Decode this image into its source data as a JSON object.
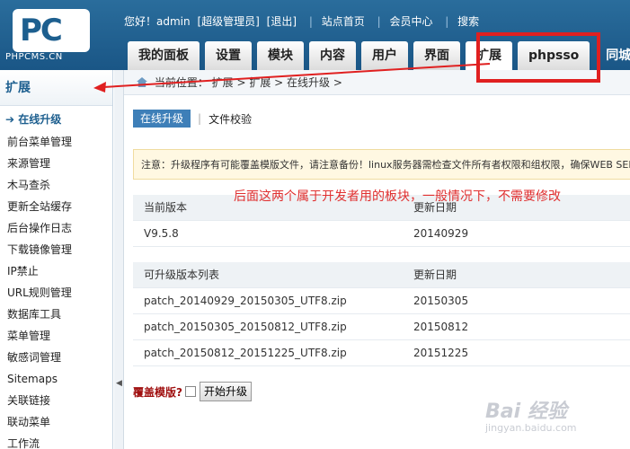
{
  "brand": {
    "logo_text": "PC",
    "logo_sub": "PHPCMS.CN"
  },
  "topbar": {
    "greeting": "您好！admin",
    "role": "[超级管理员]",
    "logout": "[退出]",
    "site_home": "站点首页",
    "member_center": "会员中心",
    "search": "搜索"
  },
  "nav_tabs": [
    "我的面板",
    "设置",
    "模块",
    "内容",
    "用户",
    "界面",
    "扩展",
    "phpsso",
    "同城"
  ],
  "sidebar": {
    "title": "扩展",
    "items": [
      "在线升级",
      "前台菜单管理",
      "来源管理",
      "木马查杀",
      "更新全站缓存",
      "后台操作日志",
      "下载镜像管理",
      "IP禁止",
      "URL规则管理",
      "数据库工具",
      "菜单管理",
      "敏感词管理",
      "Sitemaps",
      "关联链接",
      "联动菜单",
      "工作流"
    ]
  },
  "breadcrumb": {
    "prefix": "当前位置：",
    "path": "扩展 > 扩展 > 在线升级 >"
  },
  "subtabs": {
    "active": "在线升级",
    "other": "文件校验"
  },
  "notice": "注意：升级程序有可能覆盖模版文件，请注意备份！linux服务器需检查文件所有者权限和组权限，确保WEB SERVER用户有文件写入权限",
  "annotation": "后面这两个属于开发者用的板块，一般情况下，不需要修改",
  "current_version": {
    "headers": [
      "当前版本",
      "更新日期"
    ],
    "rows": [
      [
        "V9.5.8",
        "20140929"
      ]
    ]
  },
  "upgrade_list": {
    "headers": [
      "可升级版本列表",
      "更新日期"
    ],
    "rows": [
      [
        "patch_20140929_20150305_UTF8.zip",
        "20150305"
      ],
      [
        "patch_20150305_20150812_UTF8.zip",
        "20150812"
      ],
      [
        "patch_20150812_20151225_UTF8.zip",
        "20151225"
      ]
    ]
  },
  "upgrade": {
    "override_label": "覆盖模版?",
    "start_button": "开始升级"
  },
  "watermark": {
    "main": "Bai 经验",
    "sub": "jingyan.baidu.com"
  },
  "colors": {
    "header": "#1d5f8f",
    "accent": "#3e7fb8",
    "highlight": "#e02020"
  }
}
